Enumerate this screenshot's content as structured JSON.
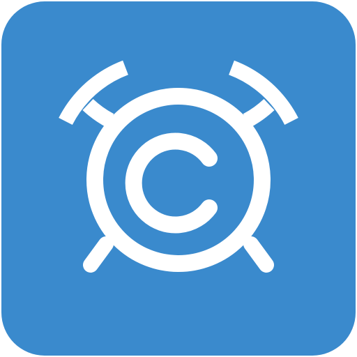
{
  "icon": {
    "name": "alarm-clock-c-icon",
    "background_color": "#3A8ACD",
    "foreground_color": "#FFFFFF",
    "letter": "C"
  }
}
